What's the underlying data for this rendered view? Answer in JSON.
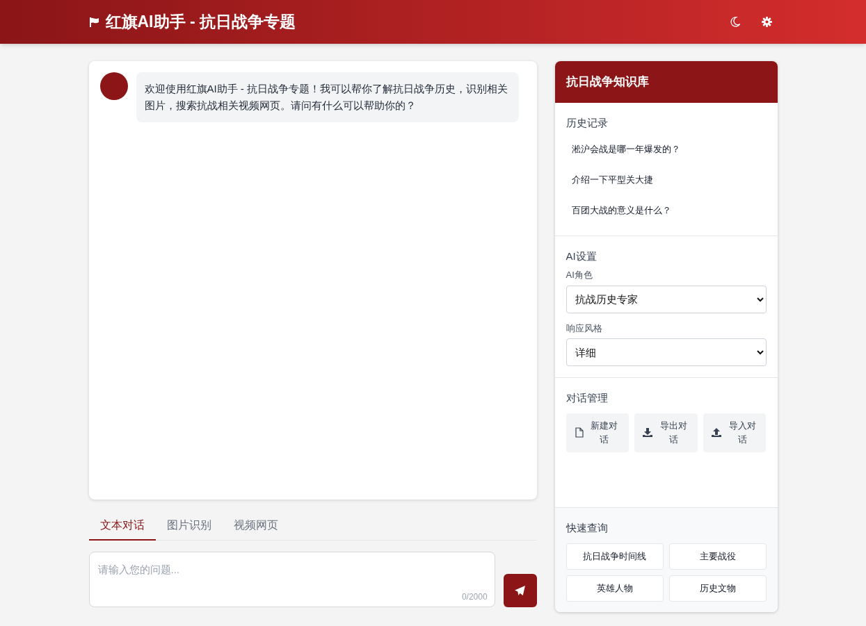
{
  "header": {
    "title": "红旗AI助手 - 抗日战争专题"
  },
  "chat": {
    "messages": [
      {
        "kind": "assistant",
        "text": "欢迎使用红旗AI助手 - 抗日战争专题！我可以帮你了解抗日战争历史，识别相关图片，搜索抗战相关视频网页。请问有什么可以帮助你的？"
      }
    ]
  },
  "tabs": [
    {
      "label": "文本对话",
      "selected": true
    },
    {
      "label": "图片识别",
      "selected": false
    },
    {
      "label": "视频网页",
      "selected": false
    }
  ],
  "input": {
    "placeholder": "请输入您的问题...",
    "counter": "0/2000"
  },
  "sidebar": {
    "title": "抗日战争知识库",
    "history": {
      "heading": "历史记录",
      "items": [
        "淞沪会战是哪一年爆发的？",
        "介绍一下平型关大捷",
        "百团大战的意义是什么？"
      ]
    },
    "settings": {
      "heading": "AI设置",
      "fields": [
        {
          "label": "AI角色",
          "value": "抗战历史专家"
        },
        {
          "label": "响应风格",
          "value": "详细"
        }
      ]
    },
    "management": {
      "heading": "对话管理",
      "buttons": [
        {
          "kind": "new",
          "label": "新建对话"
        },
        {
          "kind": "export",
          "label": "导出对话"
        },
        {
          "kind": "import",
          "label": "导入对话"
        }
      ]
    },
    "quick": {
      "heading": "快速查询",
      "buttons": [
        "抗日战争时间线",
        "主要战役",
        "英雄人物",
        "历史文物"
      ]
    }
  }
}
